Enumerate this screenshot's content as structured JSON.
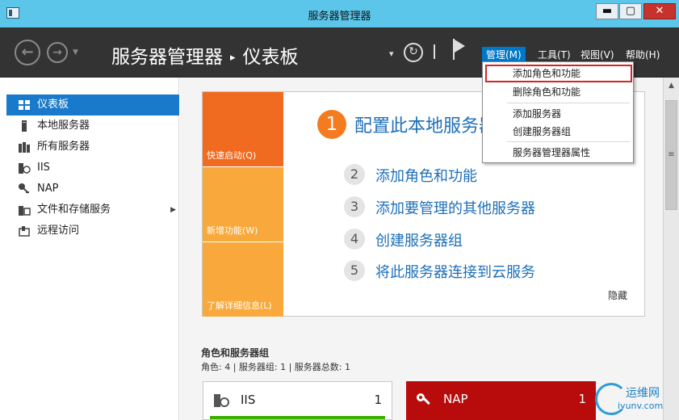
{
  "window": {
    "title": "服务器管理器",
    "minimize_glyph": "▬",
    "maximize_glyph": "▢",
    "close_glyph": "✕"
  },
  "header": {
    "back_glyph": "←",
    "forward_glyph": "→",
    "history_glyph": "▼",
    "breadcrumb_root": "服务器管理器",
    "breadcrumb_sep": "▸",
    "breadcrumb_current": "仪表板",
    "dropdown_glyph": "▾",
    "refresh_glyph": "↻",
    "menus": [
      "管理(M)",
      "工具(T)",
      "视图(V)",
      "帮助(H)"
    ]
  },
  "sidebar": {
    "items": [
      {
        "label": "仪表板",
        "icon": "dashboard-icon"
      },
      {
        "label": "本地服务器",
        "icon": "local-server-icon"
      },
      {
        "label": "所有服务器",
        "icon": "all-servers-icon"
      },
      {
        "label": "IIS",
        "icon": "iis-icon"
      },
      {
        "label": "NAP",
        "icon": "nap-icon"
      },
      {
        "label": "文件和存储服务",
        "icon": "file-storage-icon"
      },
      {
        "label": "远程访问",
        "icon": "remote-access-icon"
      }
    ],
    "expand_glyph": "▶"
  },
  "quick_start": {
    "tiles": [
      "快速启动(Q)",
      "新增功能(W)",
      "了解详细信息(L)"
    ],
    "steps": [
      {
        "num": "1",
        "label": "配置此本地服务器"
      },
      {
        "num": "2",
        "label": "添加角色和功能"
      },
      {
        "num": "3",
        "label": "添加要管理的其他服务器"
      },
      {
        "num": "4",
        "label": "创建服务器组"
      },
      {
        "num": "5",
        "label": "将此服务器连接到云服务"
      }
    ],
    "hide": "隐藏"
  },
  "roles": {
    "title": "角色和服务器组",
    "subtitle": "角色: 4 | 服务器组: 1 | 服务器总数: 1",
    "cards": [
      {
        "name": "IIS",
        "count": "1"
      },
      {
        "name": "NAP",
        "count": "1"
      }
    ]
  },
  "manage_menu": {
    "items": [
      "添加角色和功能",
      "删除角色和功能",
      "添加服务器",
      "创建服务器组",
      "服务器管理器属性"
    ]
  },
  "scrollbar": {
    "up_glyph": "▲",
    "thumb_glyph": "≡"
  },
  "watermark": {
    "line1": "运维网",
    "line2": "iyunv.com"
  },
  "colors": {
    "titlebar": "#5bc6ea",
    "header": "#333333",
    "selected": "#1979ca",
    "orange_dark": "#f06a1f",
    "orange_light": "#f9a93c",
    "link": "#1d6fb8",
    "nap_red": "#b80c0c",
    "highlight_border": "#d0262a"
  }
}
